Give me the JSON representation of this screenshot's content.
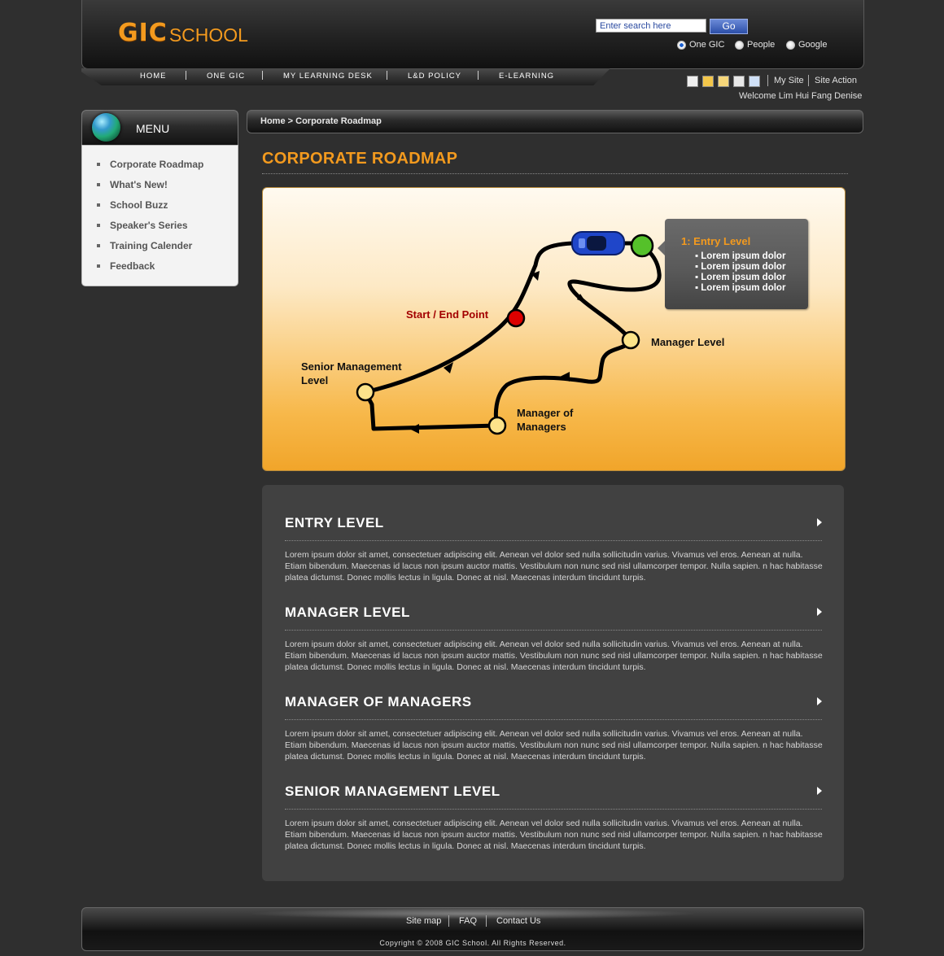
{
  "header": {
    "logo_gic": "GIC",
    "logo_school": "SCHOOL",
    "search": {
      "placeholder": "Enter search here",
      "value": "Enter search here",
      "go_label": "Go"
    },
    "search_scopes": [
      {
        "label": "One GIC",
        "selected": true
      },
      {
        "label": "People",
        "selected": false
      },
      {
        "label": "Google",
        "selected": false
      }
    ]
  },
  "nav": [
    "HOME",
    "ONE GIC",
    "MY LEARNING DESK",
    "L&D POLICY",
    "E-LEARNING"
  ],
  "utility": {
    "icons": [
      "print-icon",
      "bookmark-icon",
      "email-icon",
      "edit-icon",
      "delete-icon"
    ],
    "links": [
      "My Site",
      "Site Action"
    ],
    "welcome": "Welcome Lim Hui Fang Denise"
  },
  "sidebar": {
    "title": "MENU",
    "items": [
      "Corporate Roadmap",
      "What's New!",
      "School Buzz",
      "Speaker's Series",
      "Training Calender",
      "Feedback"
    ]
  },
  "breadcrumb": {
    "home": "Home",
    "separator": ">",
    "current": "Corporate Roadmap"
  },
  "page_title": "CORPORATE ROADMAP",
  "roadmap": {
    "start_end": "Start / End Point",
    "manager_level": "Manager Level",
    "senior_line1": "Senior Management",
    "senior_line2": "Level",
    "mom_line1": "Manager of",
    "mom_line2": "Managers",
    "callout_title": "1:  Entry Level",
    "callout_items": [
      "Lorem ipsum dolor",
      "Lorem ipsum dolor",
      "Lorem ipsum dolor",
      "Lorem ipsum dolor"
    ]
  },
  "levels": [
    {
      "title": "ENTRY LEVEL",
      "text": "Lorem ipsum dolor sit amet, consectetuer adipiscing elit. Aenean vel dolor sed nulla sollicitudin varius. Vivamus vel eros. Aenean at nulla. Etiam bibendum. Maecenas id lacus non ipsum auctor mattis. Vestibulum non nunc sed nisl ullamcorper tempor. Nulla sapien. n hac habitasse platea dictumst. Donec mollis lectus in ligula. Donec at nisl. Maecenas interdum tincidunt turpis."
    },
    {
      "title": "MANAGER LEVEL",
      "text": "Lorem ipsum dolor sit amet, consectetuer adipiscing elit. Aenean vel dolor sed nulla sollicitudin varius. Vivamus vel eros. Aenean at nulla. Etiam bibendum. Maecenas id lacus non ipsum auctor mattis. Vestibulum non nunc sed nisl ullamcorper tempor. Nulla sapien. n hac habitasse platea dictumst. Donec mollis lectus in ligula. Donec at nisl. Maecenas interdum tincidunt turpis."
    },
    {
      "title": "MANAGER OF MANAGERS",
      "text": "Lorem ipsum dolor sit amet, consectetuer adipiscing elit. Aenean vel dolor sed nulla sollicitudin varius. Vivamus vel eros. Aenean at nulla. Etiam bibendum. Maecenas id lacus non ipsum auctor mattis. Vestibulum non nunc sed nisl ullamcorper tempor. Nulla sapien. n hac habitasse platea dictumst. Donec mollis lectus in ligula. Donec at nisl. Maecenas interdum tincidunt turpis."
    },
    {
      "title": "SENIOR MANAGEMENT LEVEL",
      "text": "Lorem ipsum dolor sit amet, consectetuer adipiscing elit. Aenean vel dolor sed nulla sollicitudin varius. Vivamus vel eros. Aenean at nulla. Etiam bibendum. Maecenas id lacus non ipsum auctor mattis. Vestibulum non nunc sed nisl ullamcorper tempor. Nulla sapien. n hac habitasse platea dictumst. Donec mollis lectus in ligula. Donec at nisl. Maecenas interdum tincidunt turpis."
    }
  ],
  "footer": {
    "links": [
      "Site map",
      "FAQ",
      "Contact Us"
    ],
    "copyright": "Copyright © 2008 GIC School. All Rights Reserved."
  },
  "colors": {
    "accent": "#f39a1e",
    "background": "#2f2f2f",
    "panel": "#414141"
  }
}
